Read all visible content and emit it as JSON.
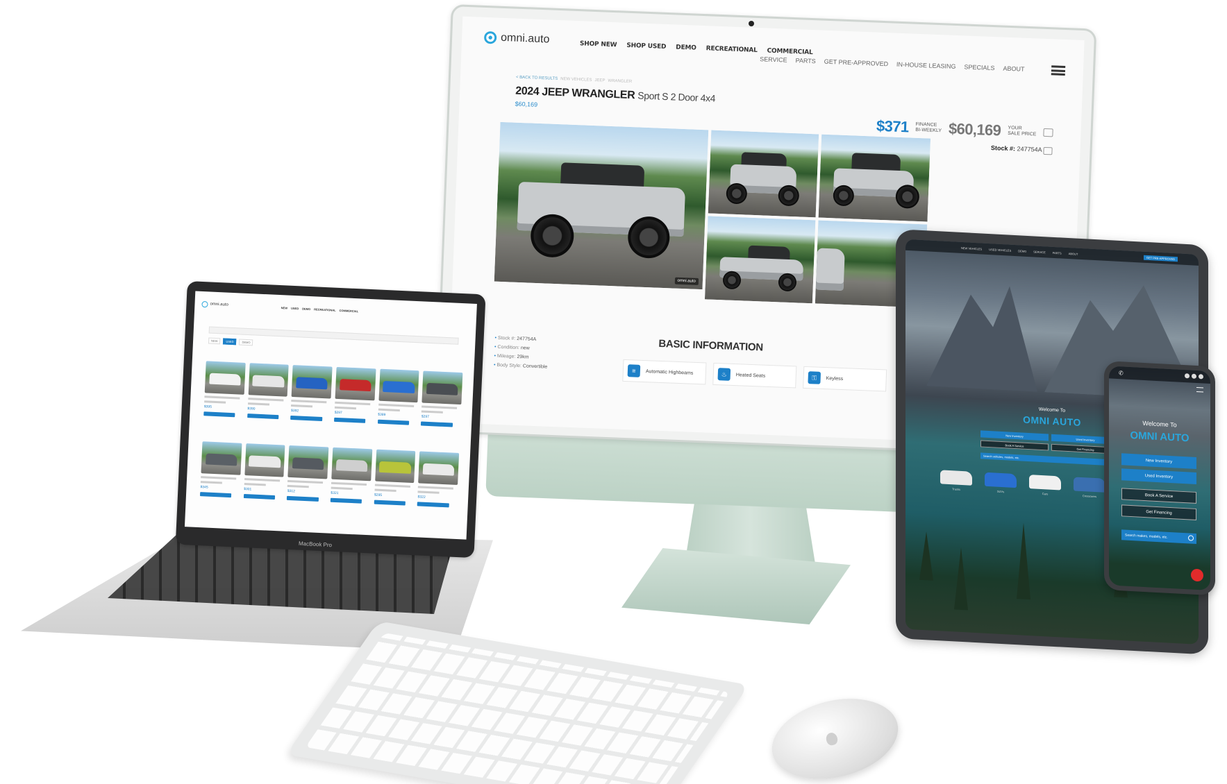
{
  "desktop": {
    "logo_text": "omni.auto",
    "nav_main": [
      "SHOP NEW",
      "SHOP USED",
      "DEMO",
      "RECREATIONAL",
      "COMMERCIAL"
    ],
    "nav_secondary": [
      "SERVICE",
      "PARTS",
      "GET PRE-APPROVED",
      "IN-HOUSE LEASING",
      "SPECIALS",
      "ABOUT"
    ],
    "breadcrumb": [
      "< BACK TO RESULTS",
      "NEW VEHICLES",
      "JEEP",
      "WRANGLER"
    ],
    "vehicle_title": "2024 JEEP WRANGLER",
    "vehicle_trim": "Sport S 2 Door 4x4",
    "title_price": "$60,169",
    "finance_amount": "$371",
    "finance_label_1": "FINANCE",
    "finance_label_2": "BI-WEEKLY",
    "sale_price": "$60,169",
    "sale_label_1": "YOUR",
    "sale_label_2": "SALE PRICE",
    "stock_label": "Stock #:",
    "stock_value": "247754A",
    "basic_info_title": "BASIC INFORMATION",
    "specs": [
      {
        "label": "Stock #:",
        "value": "247754A"
      },
      {
        "label": "Condition:",
        "value": "new"
      },
      {
        "label": "Mileage:",
        "value": "29km"
      },
      {
        "label": "Body Style:",
        "value": "Convertible"
      }
    ],
    "features": [
      "Automatic Highbeams",
      "Heated Seats",
      "Keyless"
    ]
  },
  "laptop": {
    "logo_text": "omni.auto",
    "nav": [
      "NEW",
      "USED",
      "DEMO",
      "RECREATIONAL",
      "COMMERCIAL"
    ],
    "brand_label": "MacBook Pro",
    "filters": [
      "NEW",
      "USED",
      "DEMO"
    ],
    "cards": [
      {
        "price": "$395",
        "color": "#f2f2f2"
      },
      {
        "price": "$390",
        "color": "#e6e6e6"
      },
      {
        "price": "$392",
        "color": "#2563c2"
      },
      {
        "price": "$297",
        "color": "#c52a2a"
      },
      {
        "price": "$389",
        "color": "#2a6fd1"
      },
      {
        "price": "$297",
        "color": "#4a4e53"
      },
      {
        "price": "$345",
        "color": "#5a6066"
      },
      {
        "price": "$301",
        "color": "#e9e9e9"
      },
      {
        "price": "$312",
        "color": "#555a60"
      },
      {
        "price": "$321",
        "color": "#cfcfcf"
      },
      {
        "price": "$295",
        "color": "#b8c43a"
      },
      {
        "price": "$322",
        "color": "#eaeaea"
      }
    ]
  },
  "tablet": {
    "nav": [
      "NEW VEHICLES",
      "USED VEHICLES",
      "DEMO",
      "SERVICE",
      "PARTS",
      "ABOUT"
    ],
    "cta": "GET PRE-APPROVED",
    "welcome_small": "Welcome To",
    "welcome_big": "OMNI AUTO",
    "buttons": [
      "New Inventory",
      "Used Inventory",
      "Book A Service",
      "Get Financing"
    ],
    "search_placeholder": "Search vehicles, models, etc.",
    "cars": [
      {
        "label": "Trucks",
        "color": "#e8e8e8"
      },
      {
        "label": "SUVs",
        "color": "#2a6fd1"
      },
      {
        "label": "Cars",
        "color": "#f0f0f0"
      },
      {
        "label": "Crossovers",
        "color": "#3a6fb0"
      }
    ]
  },
  "phone": {
    "welcome_small": "Welcome To",
    "welcome_big": "OMNI AUTO",
    "buttons": [
      "New Inventory",
      "Used Inventory",
      "Book A Service",
      "Get Financing"
    ],
    "search_placeholder": "Search makes, models, etc."
  }
}
